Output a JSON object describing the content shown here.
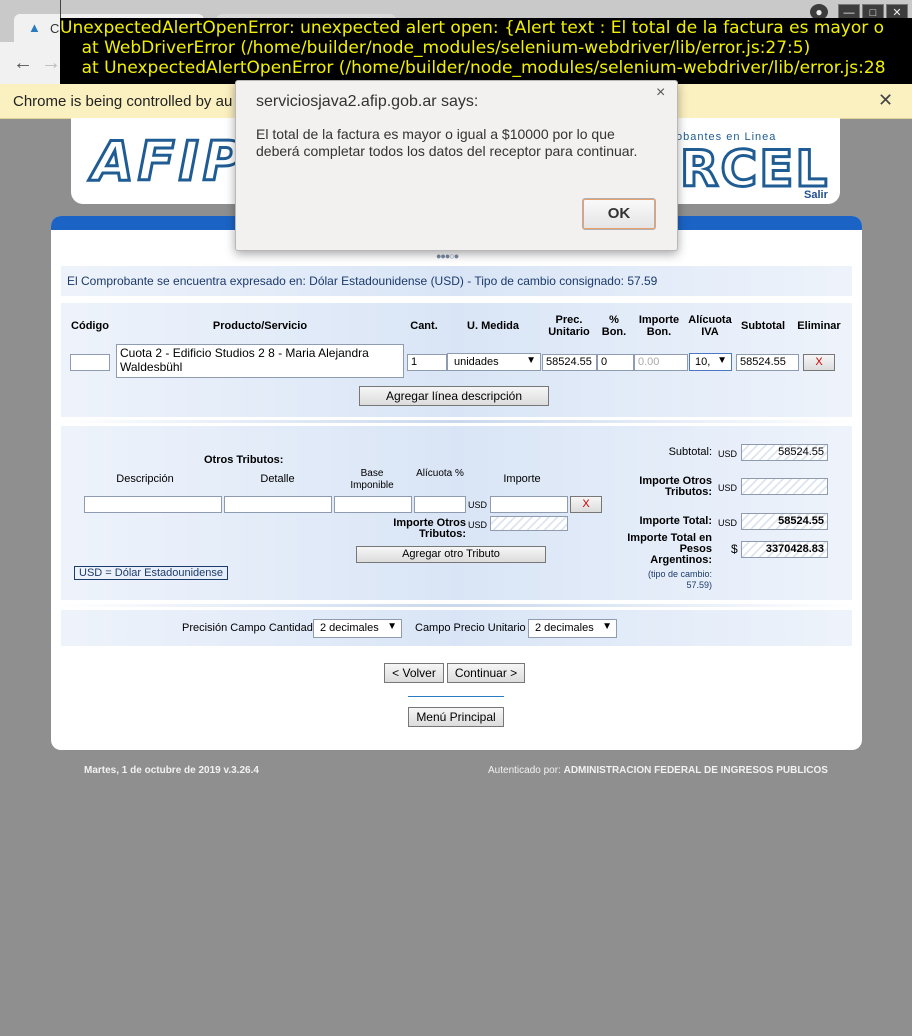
{
  "browser": {
    "tab_title": "C",
    "infobar_text": "Chrome is being controlled by au",
    "window_buttons": [
      "⊖",
      "—",
      "□",
      "✕"
    ]
  },
  "error_overlay": {
    "lines": [
      "UnexpectedAlertOpenError: unexpected alert open: {Alert text : El total de la factura es mayor o",
      "    at WebDriverError (/home/builder/node_modules/selenium-webdriver/lib/error.js:27:5)",
      "    at UnexpectedAlertOpenError (/home/builder/node_modules/selenium-webdriver/lib/error.js:28"
    ]
  },
  "header": {
    "logo_left": "AFIP",
    "logo_right": "RCEL",
    "logo_sub": "obantes en Linea",
    "salir": "Salir"
  },
  "page": {
    "step_dots": "●●●○●",
    "currency_info": "El Comprobante se encuentra expresado en: Dólar Estadounidense (USD) - Tipo de cambio consignado: 57.59",
    "table_headers": {
      "codigo": "Código",
      "producto": "Producto/Servicio",
      "cant": "Cant.",
      "umedida": "U. Medida",
      "prec": "Prec. Unitario",
      "pbon": "% Bon.",
      "ibon": "Importe Bon.",
      "aliva": "Alícuota IVA",
      "subtotal": "Subtotal",
      "eliminar": "Eliminar"
    },
    "line": {
      "codigo": "",
      "producto": "Cuota 2 - Edificio Studios 2 8  - Maria Alejandra Waldesbühl",
      "cantidad": "1",
      "umedida": "unidades",
      "precio": "58524.55",
      "pbon": "0",
      "ibon_placeholder": "0.00",
      "aliva": "10,",
      "subtotal": "58524.55",
      "eliminar": "X"
    },
    "agregar_linea": "Agregar línea descripción",
    "tributos": {
      "title": "Otros Tributos:",
      "headers": {
        "descripcion": "Descripción",
        "detalle": "Detalle",
        "base": "Base Imponible",
        "alicuota": "Alícuota %",
        "importe": "Importe"
      },
      "usd": "USD",
      "eliminar": "X",
      "importe_label": "Importe Otros Tributos:",
      "agregar": "Agregar otro Tributo"
    },
    "totales": {
      "subtotal_label": "Subtotal:",
      "subtotal_value": "58524.55",
      "otros_label": "Importe Otros Tributos:",
      "otros_value": "",
      "total_label": "Importe Total:",
      "total_value": "58524.55",
      "pesos_label": "Importe Total en Pesos Argentinos:",
      "pesos_symbol": "$",
      "pesos_value": "3370428.83",
      "tipo_cambio": "(tipo de cambio: 57.59)",
      "usd": "USD"
    },
    "usd_legend": "USD = Dólar Estadounidense",
    "precision": {
      "cantidad_label": "Precisión Campo Cantidad",
      "cantidad_value": "2 decimales",
      "precio_label": "Campo Precio Unitario",
      "precio_value": "2 decimales"
    },
    "volver": "< Volver",
    "continuar": "Continuar >",
    "menu": "Menú Principal"
  },
  "footer": {
    "date": "Martes, 1 de octubre de 2019 v.3.26.4",
    "auth_prefix": "Autenticado por: ",
    "auth_entity": "ADMINISTRACION FEDERAL DE INGRESOS PUBLICOS"
  },
  "dialog": {
    "title": "serviciosjava2.afip.gob.ar says:",
    "message": "El total de la factura es mayor o igual a $10000 por lo que deberá completar todos los datos del receptor para continuar.",
    "ok": "OK",
    "close": "×"
  },
  "colors": {
    "accent_blue": "#1b64c6",
    "error_text": "#f0f000",
    "infobar": "#fbf0c0"
  }
}
